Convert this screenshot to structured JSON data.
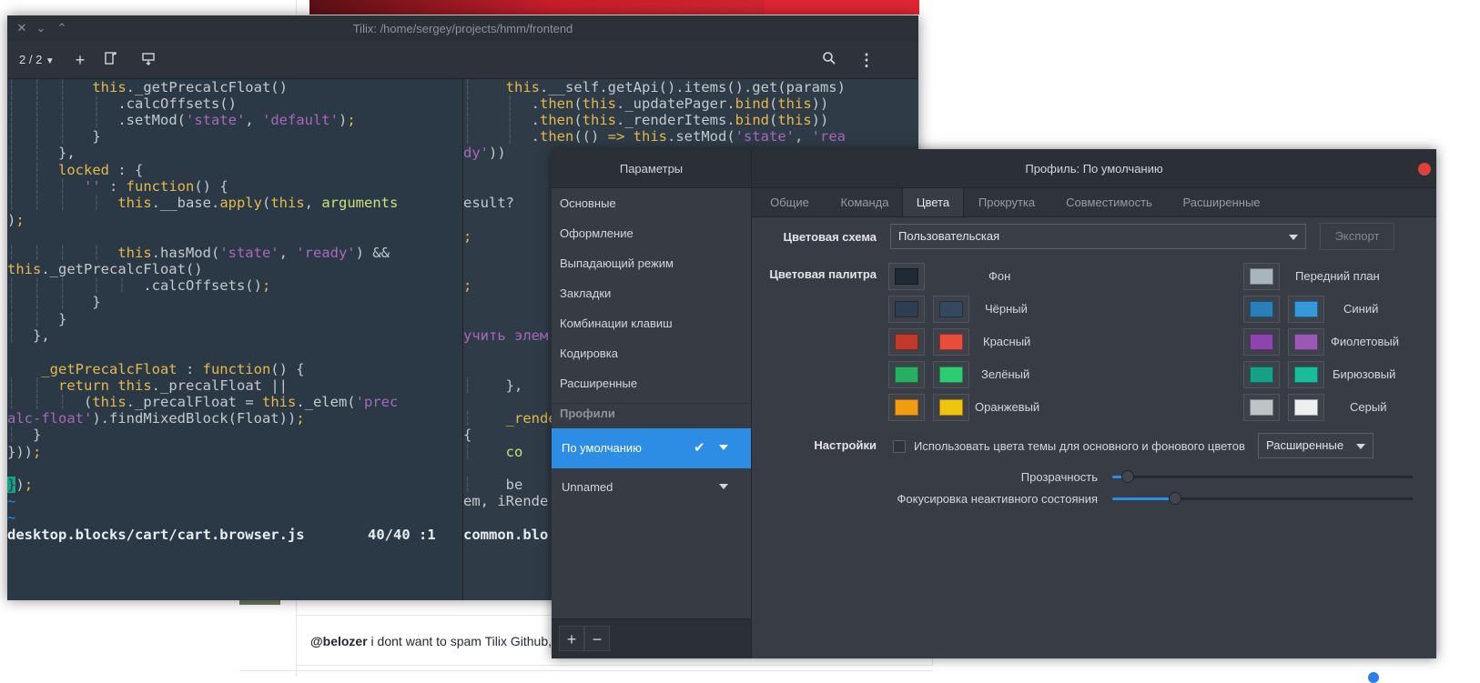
{
  "background": {
    "comment_user": "@belozer",
    "comment_text": " i dont want to spam Tilix Github,"
  },
  "tilix": {
    "title": "Tilix: /home/sergey/projects/hmm/frontend",
    "session_counter": "2 / 2",
    "left_statusbar": {
      "file": "desktop.blocks/cart/cart.browser.js",
      "position": "40/40 :1"
    },
    "right_statusbar": {
      "file": "common.blo"
    }
  },
  "prefs": {
    "sidebar_title": "Параметры",
    "main_title": "Профиль: По умолчанию",
    "sidebar_items": [
      "Основные",
      "Оформление",
      "Выпадающий режим",
      "Закладки",
      "Комбинации клавиш",
      "Кодировка",
      "Расширенные"
    ],
    "profiles_header": "Профили",
    "profiles": [
      {
        "name": "По умолчанию",
        "selected": true
      },
      {
        "name": "Unnamed",
        "selected": false
      }
    ],
    "add_label": "+",
    "remove_label": "−",
    "tabs": [
      "Общие",
      "Команда",
      "Цвета",
      "Прокрутка",
      "Совместимость",
      "Расширенные"
    ],
    "active_tab": "Цвета",
    "color_scheme_label": "Цветовая схема",
    "color_scheme_value": "Пользовательская",
    "export_label": "Экспорт",
    "palette_label": "Цветовая палитра",
    "palette": {
      "background": {
        "label": "Фон",
        "color": "#1f2a35"
      },
      "foreground": {
        "label": "Передний план",
        "color": "#a9b5bd"
      },
      "left_rows": [
        {
          "label": "Чёрный",
          "normal": "#2c3e50",
          "bright": "#34495e"
        },
        {
          "label": "Красный",
          "normal": "#c0392b",
          "bright": "#e74c3c"
        },
        {
          "label": "Зелёный",
          "normal": "#27ae60",
          "bright": "#2ecc71"
        },
        {
          "label": "Оранжевый",
          "normal": "#f39c12",
          "bright": "#f1c40f"
        }
      ],
      "right_rows": [
        {
          "label": "Синий",
          "normal": "#2980b9",
          "bright": "#3498db"
        },
        {
          "label": "Фиолетовый",
          "normal": "#8e44ad",
          "bright": "#9b59b6"
        },
        {
          "label": "Бирюзовый",
          "normal": "#16a085",
          "bright": "#1abc9c"
        },
        {
          "label": "Серый",
          "normal": "#bdc3c7",
          "bright": "#ecf0f1"
        }
      ]
    },
    "settings_label": "Настройки",
    "use_theme_colors": "Использовать цвета темы для основного и фонового цветов",
    "advanced_combo": "Расширенные",
    "transparency_label": "Прозрачность",
    "transparency_value": 0.05,
    "dim_label": "Фокусировка неактивного состояния",
    "dim_value": 0.21
  }
}
